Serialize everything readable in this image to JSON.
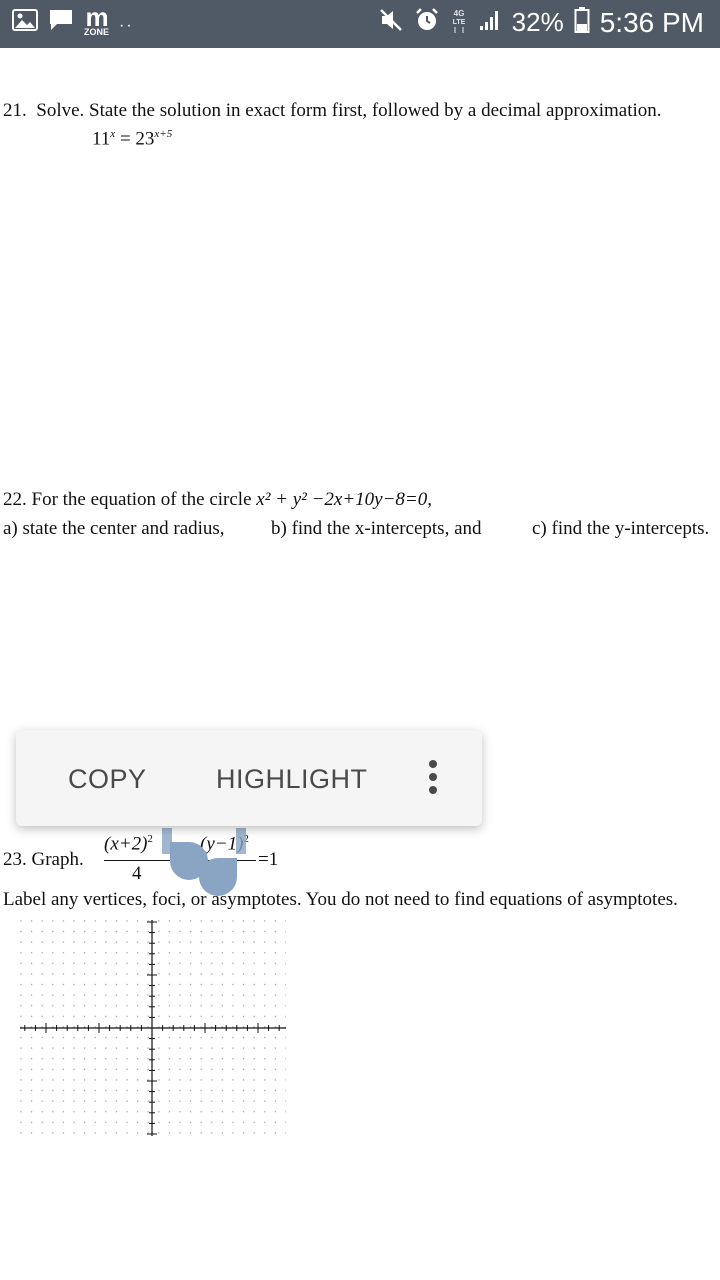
{
  "status_bar": {
    "app_label_m": "m",
    "app_label_zone": "ZONE",
    "dots": "··",
    "network": "4G LTE",
    "battery": "32%",
    "time": "5:36 PM",
    "icons": [
      "image-icon",
      "message-icon",
      "mute-icon",
      "alarm-icon",
      "network-icon",
      "signal-icon",
      "battery-icon"
    ]
  },
  "q21": {
    "number": "21.",
    "text": "Solve. State the solution in exact form first, followed by a decimal approximation.",
    "eq_base_left": "11",
    "eq_exp_left": "x",
    "eq_equals": " = 23",
    "eq_exp_right": "x+5"
  },
  "q22": {
    "intro": "22. For the equation of the circle ",
    "equation": "x² + y² −2x+10y−8=0,",
    "part_a": "a) state the center and radius,",
    "part_b": "b) find the x-intercepts, and",
    "part_c": "c) find the y-intercepts."
  },
  "popup": {
    "copy": "COPY",
    "highlight": "HIGHLIGHT"
  },
  "q23": {
    "label": "23.  Graph.",
    "num_left": "(x+2)",
    "exp_left": "2",
    "den_left": "4",
    "num_right": "(y−1)",
    "exp_right": "2",
    "equals": "=1",
    "instruction": "Label any vertices, foci, or asymptotes. You do not need to find equations of asymptotes."
  }
}
